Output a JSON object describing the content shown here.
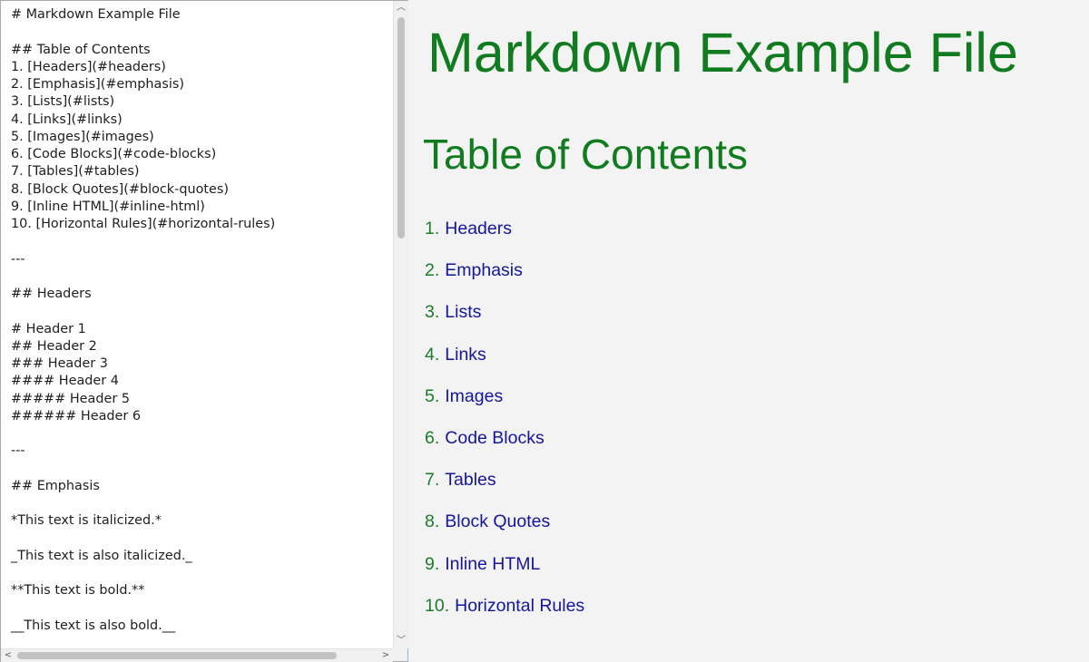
{
  "editor": {
    "lines": [
      "# Markdown Example File",
      "",
      "## Table of Contents",
      "1. [Headers](#headers)",
      "2. [Emphasis](#emphasis)",
      "3. [Lists](#lists)",
      "4. [Links](#links)",
      "5. [Images](#images)",
      "6. [Code Blocks](#code-blocks)",
      "7. [Tables](#tables)",
      "8. [Block Quotes](#block-quotes)",
      "9. [Inline HTML](#inline-html)",
      "10. [Horizontal Rules](#horizontal-rules)",
      "",
      "---",
      "",
      "## Headers",
      "",
      "# Header 1",
      "## Header 2",
      "### Header 3",
      "#### Header 4",
      "##### Header 5",
      "###### Header 6",
      "",
      "---",
      "",
      "## Emphasis",
      "",
      "*This text is italicized.*",
      "",
      "_This text is also italicized._",
      "",
      "**This text is bold.**",
      "",
      "__This text is also bold.__"
    ],
    "scroll_up": "︿",
    "scroll_down": "﹀",
    "scroll_left": "<",
    "scroll_right": ">"
  },
  "preview": {
    "title": "Markdown Example File",
    "toc_heading": "Table of Contents",
    "toc": [
      {
        "num": "1.",
        "label": "Headers"
      },
      {
        "num": "2.",
        "label": "Emphasis"
      },
      {
        "num": "3.",
        "label": "Lists"
      },
      {
        "num": "4.",
        "label": "Links"
      },
      {
        "num": "5.",
        "label": "Images"
      },
      {
        "num": "6.",
        "label": "Code Blocks"
      },
      {
        "num": "7.",
        "label": "Tables"
      },
      {
        "num": "8.",
        "label": "Block Quotes"
      },
      {
        "num": "9.",
        "label": "Inline HTML"
      },
      {
        "num": "10.",
        "label": "Horizontal Rules"
      }
    ]
  },
  "colors": {
    "heading_green": "#117c1f",
    "number_green": "#1a7c2a",
    "link_blue": "#14169c",
    "pane_divider": "#8fb8cf"
  }
}
